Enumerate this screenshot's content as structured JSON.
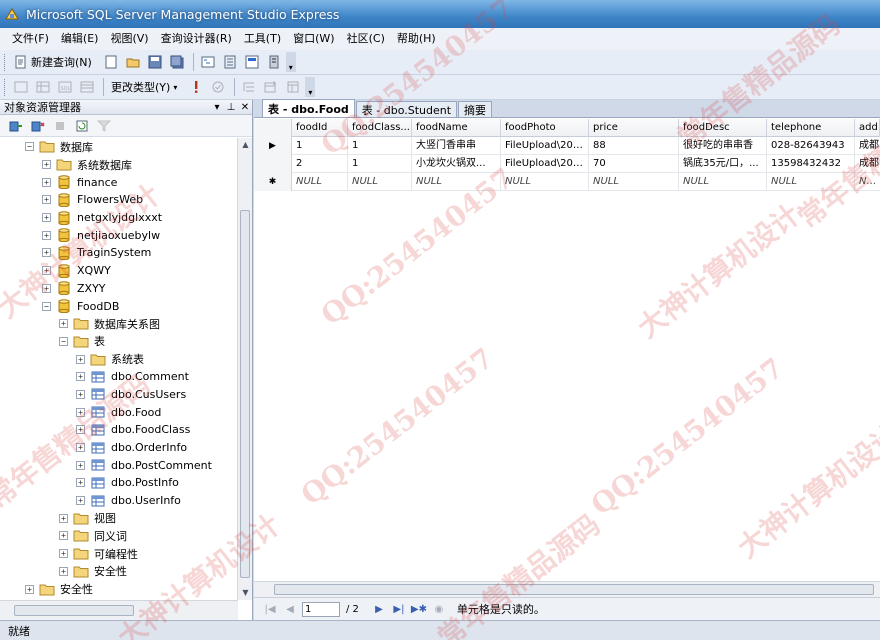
{
  "window": {
    "title": "Microsoft SQL Server Management Studio Express"
  },
  "menu": [
    "文件(F)",
    "编辑(E)",
    "视图(V)",
    "查询设计器(R)",
    "工具(T)",
    "窗口(W)",
    "社区(C)",
    "帮助(H)"
  ],
  "toolbar1": {
    "new_query": "新建查询(N)"
  },
  "toolbar2": {
    "change_type": "更改类型(Y)"
  },
  "explorer": {
    "title": "对象资源管理器",
    "tree": [
      {
        "label": "数据库",
        "depth": 1,
        "expanded": true,
        "icon": "folder"
      },
      {
        "label": "系统数据库",
        "depth": 2,
        "expanded": false,
        "icon": "folder"
      },
      {
        "label": "finance",
        "depth": 2,
        "expanded": false,
        "icon": "database"
      },
      {
        "label": "FlowersWeb",
        "depth": 2,
        "expanded": false,
        "icon": "database"
      },
      {
        "label": "netgxlyjdglxxxt",
        "depth": 2,
        "expanded": false,
        "icon": "database"
      },
      {
        "label": "netjiaoxuebylw",
        "depth": 2,
        "expanded": false,
        "icon": "database"
      },
      {
        "label": "TraginSystem",
        "depth": 2,
        "expanded": false,
        "icon": "database"
      },
      {
        "label": "XQWY",
        "depth": 2,
        "expanded": false,
        "icon": "database"
      },
      {
        "label": "ZXYY",
        "depth": 2,
        "expanded": false,
        "icon": "database"
      },
      {
        "label": "FoodDB",
        "depth": 2,
        "expanded": true,
        "icon": "database"
      },
      {
        "label": "数据库关系图",
        "depth": 3,
        "expanded": false,
        "icon": "folder"
      },
      {
        "label": "表",
        "depth": 3,
        "expanded": true,
        "icon": "folder"
      },
      {
        "label": "系统表",
        "depth": 4,
        "expanded": false,
        "icon": "folder"
      },
      {
        "label": "dbo.Comment",
        "depth": 4,
        "expanded": false,
        "icon": "table"
      },
      {
        "label": "dbo.CusUsers",
        "depth": 4,
        "expanded": false,
        "icon": "table"
      },
      {
        "label": "dbo.Food",
        "depth": 4,
        "expanded": false,
        "icon": "table"
      },
      {
        "label": "dbo.FoodClass",
        "depth": 4,
        "expanded": false,
        "icon": "table"
      },
      {
        "label": "dbo.OrderInfo",
        "depth": 4,
        "expanded": false,
        "icon": "table"
      },
      {
        "label": "dbo.PostComment",
        "depth": 4,
        "expanded": false,
        "icon": "table"
      },
      {
        "label": "dbo.PostInfo",
        "depth": 4,
        "expanded": false,
        "icon": "table"
      },
      {
        "label": "dbo.UserInfo",
        "depth": 4,
        "expanded": false,
        "icon": "table"
      },
      {
        "label": "视图",
        "depth": 3,
        "expanded": false,
        "icon": "folder"
      },
      {
        "label": "同义词",
        "depth": 3,
        "expanded": false,
        "icon": "folder"
      },
      {
        "label": "可编程性",
        "depth": 3,
        "expanded": false,
        "icon": "folder"
      },
      {
        "label": "安全性",
        "depth": 3,
        "expanded": false,
        "icon": "folder"
      },
      {
        "label": "安全性",
        "depth": 1,
        "expanded": false,
        "icon": "folder"
      }
    ]
  },
  "tabs": [
    {
      "label": "表 - dbo.Food",
      "active": true
    },
    {
      "label": "表 - dbo.Student",
      "active": false
    },
    {
      "label": "摘要",
      "active": false
    }
  ],
  "grid": {
    "columns": [
      "foodId",
      "foodClass...",
      "foodName",
      "foodPhoto",
      "price",
      "foodDesc",
      "telephone",
      "add"
    ],
    "rows": [
      {
        "marker": "▶",
        "cells": [
          "1",
          "1",
          "大竖门香串串",
          "FileUpload\\2017...",
          "88",
          "很好吃的串串香",
          "028-82643943",
          "成都"
        ]
      },
      {
        "marker": "",
        "cells": [
          "2",
          "1",
          "小龙坎火锅双...",
          "FileUpload\\2017...",
          "70",
          "锅底35元/口，...",
          "13598432432",
          "成都"
        ]
      },
      {
        "marker": "✱",
        "cells": [
          "NULL",
          "NULL",
          "NULL",
          "NULL",
          "NULL",
          "NULL",
          "NULL",
          "NULL"
        ]
      }
    ]
  },
  "navigator": {
    "current_page": "1",
    "total": "/ 2",
    "status": "单元格是只读的。"
  },
  "statusbar": {
    "text": "就绪"
  },
  "watermarks": [
    "QQ:254540457",
    "大神计算机设计",
    "常年售精品源码"
  ]
}
